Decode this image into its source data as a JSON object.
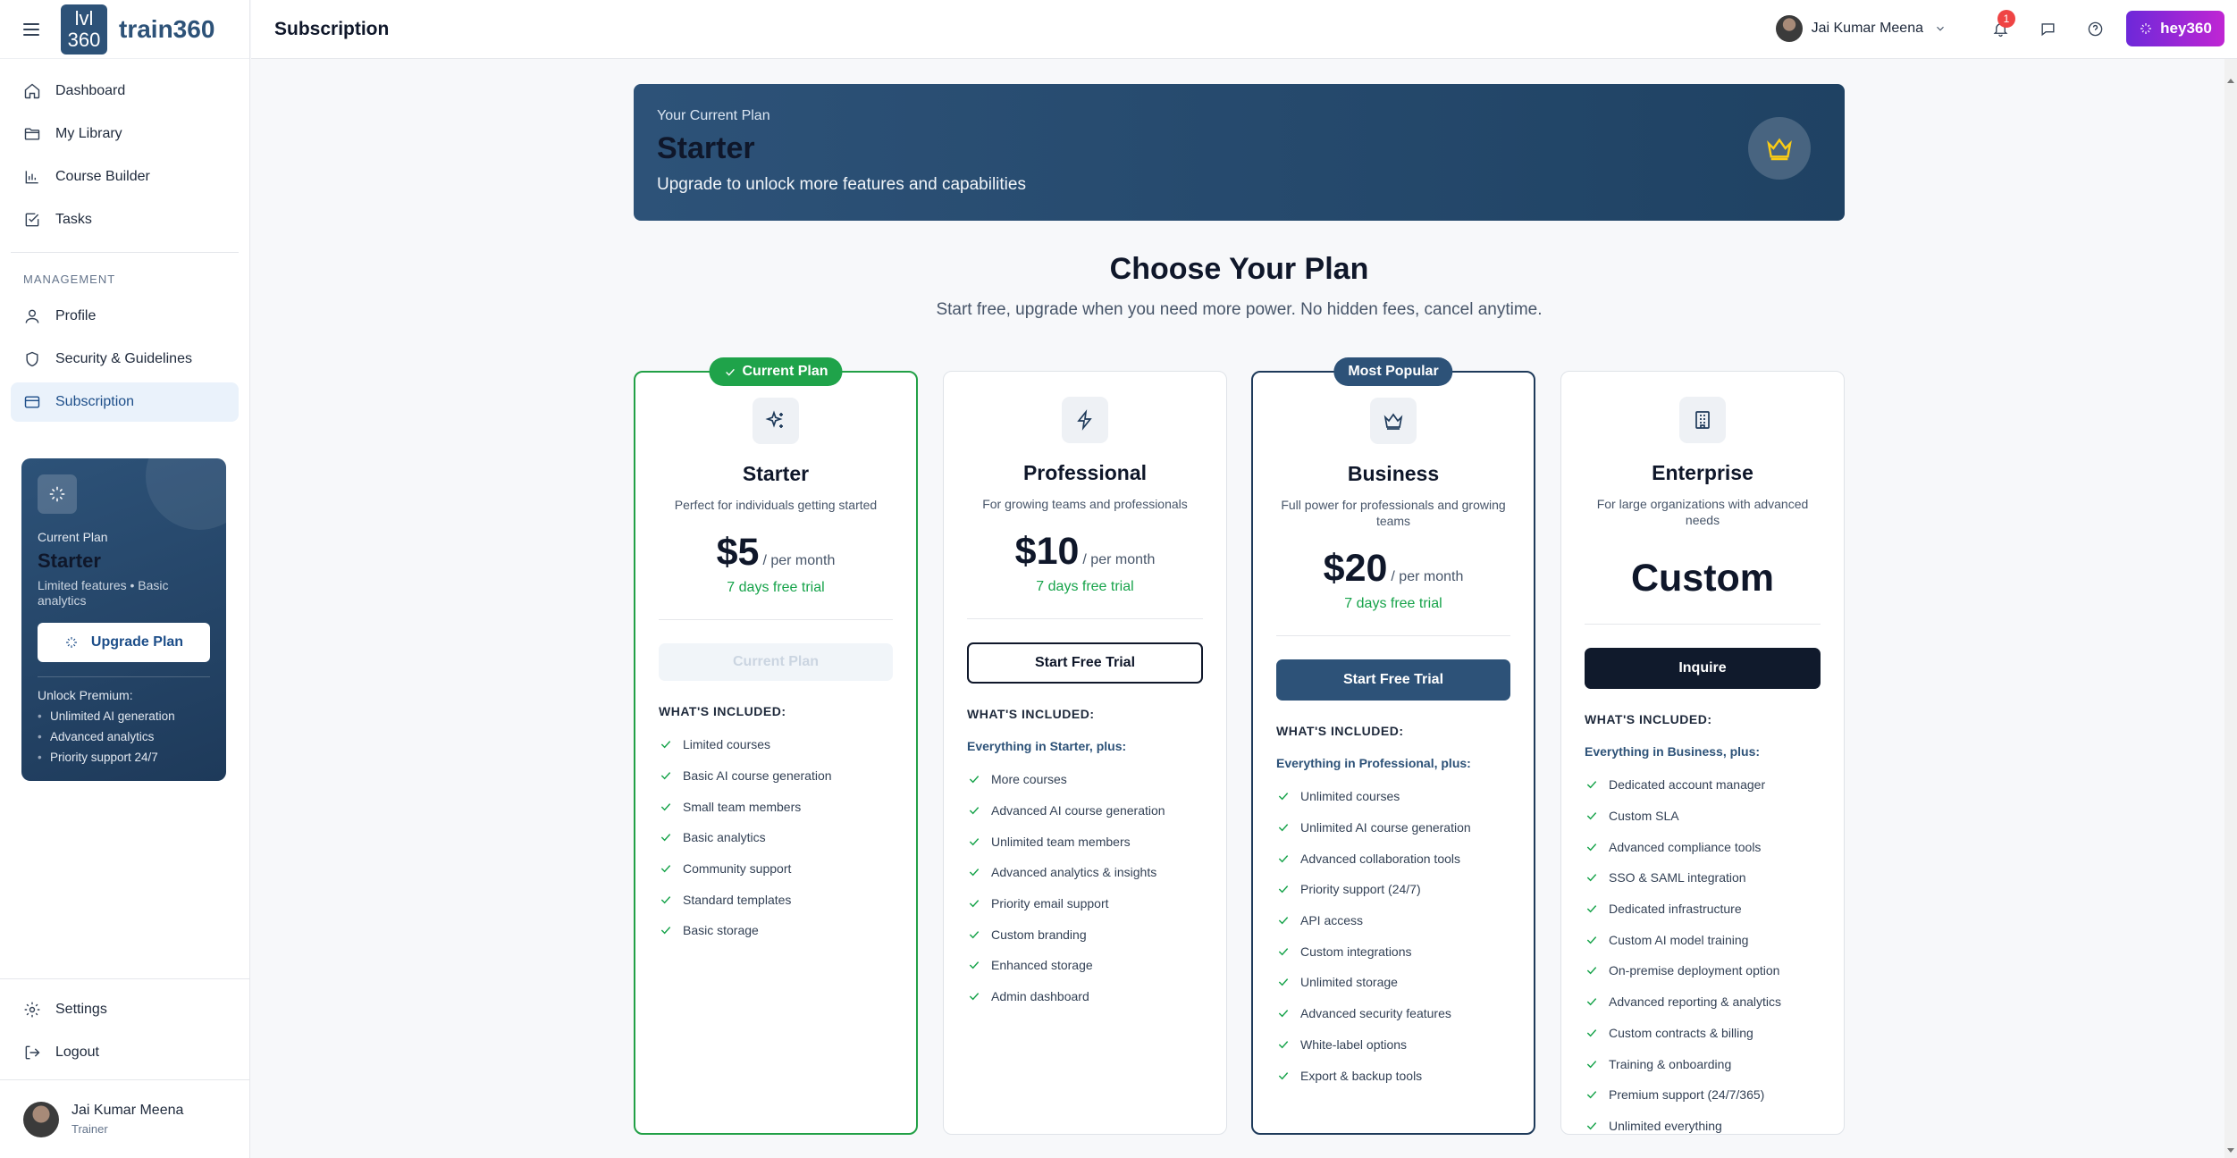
{
  "brand": {
    "logo_line1": "lvl",
    "logo_line2": "360",
    "name": "train360"
  },
  "header": {
    "title": "Subscription",
    "user_name": "Jai Kumar Meena",
    "notification_count": "1",
    "assistant_label": "hey360"
  },
  "sidebar": {
    "items": [
      {
        "label": "Dashboard",
        "icon": "home-icon"
      },
      {
        "label": "My Library",
        "icon": "folder-icon"
      },
      {
        "label": "Course Builder",
        "icon": "bar-chart-icon"
      },
      {
        "label": "Tasks",
        "icon": "check-square-icon"
      }
    ],
    "management_label": "MANAGEMENT",
    "management_items": [
      {
        "label": "Profile",
        "icon": "user-icon"
      },
      {
        "label": "Security & Guidelines",
        "icon": "shield-icon"
      },
      {
        "label": "Subscription",
        "icon": "credit-card-icon",
        "active": true
      }
    ],
    "promo": {
      "current_label": "Current Plan",
      "plan": "Starter",
      "desc": "Limited features • Basic analytics",
      "button": "Upgrade Plan",
      "unlock_label": "Unlock Premium:",
      "unlock_items": [
        "Unlimited AI generation",
        "Advanced analytics",
        "Priority support 24/7"
      ]
    },
    "bottom_items": [
      {
        "label": "Settings",
        "icon": "gear-icon"
      },
      {
        "label": "Logout",
        "icon": "logout-icon"
      }
    ],
    "user": {
      "name": "Jai Kumar Meena",
      "role": "Trainer"
    }
  },
  "hero": {
    "label": "Your Current Plan",
    "plan": "Starter",
    "subtitle": "Upgrade to unlock more features and capabilities"
  },
  "plans_section": {
    "title": "Choose Your Plan",
    "subtitle": "Start free, upgrade when you need more power. No hidden fees, cancel anytime."
  },
  "plans": [
    {
      "badge": "Current Plan",
      "name": "Starter",
      "desc": "Perfect for individuals getting started",
      "price": "$5",
      "period": "/ per month",
      "trial": "7 days free trial",
      "button": "Current Plan",
      "included_label": "WHAT'S INCLUDED:",
      "plus": "",
      "features": [
        "Limited courses",
        "Basic AI course generation",
        "Small team members",
        "Basic analytics",
        "Community support",
        "Standard templates",
        "Basic storage"
      ]
    },
    {
      "badge": "",
      "name": "Professional",
      "desc": "For growing teams and professionals",
      "price": "$10",
      "period": "/ per month",
      "trial": "7 days free trial",
      "button": "Start Free Trial",
      "included_label": "WHAT'S INCLUDED:",
      "plus": "Everything in Starter, plus:",
      "features": [
        "More courses",
        "Advanced AI course generation",
        "Unlimited team members",
        "Advanced analytics & insights",
        "Priority email support",
        "Custom branding",
        "Enhanced storage",
        "Admin dashboard"
      ]
    },
    {
      "badge": "Most Popular",
      "name": "Business",
      "desc": "Full power for professionals and growing teams",
      "price": "$20",
      "period": "/ per month",
      "trial": "7 days free trial",
      "button": "Start Free Trial",
      "included_label": "WHAT'S INCLUDED:",
      "plus": "Everything in Professional, plus:",
      "features": [
        "Unlimited courses",
        "Unlimited AI course generation",
        "Advanced collaboration tools",
        "Priority support (24/7)",
        "API access",
        "Custom integrations",
        "Unlimited storage",
        "Advanced security features",
        "White-label options",
        "Export & backup tools"
      ]
    },
    {
      "badge": "",
      "name": "Enterprise",
      "desc": "For large organizations with advanced needs",
      "price": "Custom",
      "period": "",
      "trial": "",
      "button": "Inquire",
      "included_label": "WHAT'S INCLUDED:",
      "plus": "Everything in Business, plus:",
      "features": [
        "Dedicated account manager",
        "Custom SLA",
        "Advanced compliance tools",
        "SSO & SAML integration",
        "Dedicated infrastructure",
        "Custom AI model training",
        "On-premise deployment option",
        "Advanced reporting & analytics",
        "Custom contracts & billing",
        "Training & onboarding",
        "Premium support (24/7/365)",
        "Unlimited everything"
      ]
    }
  ],
  "colors": {
    "brand": "#2d5278",
    "success": "#16a34a",
    "accent_gradient_start": "#6d28d9",
    "accent_gradient_end": "#c026d3"
  }
}
